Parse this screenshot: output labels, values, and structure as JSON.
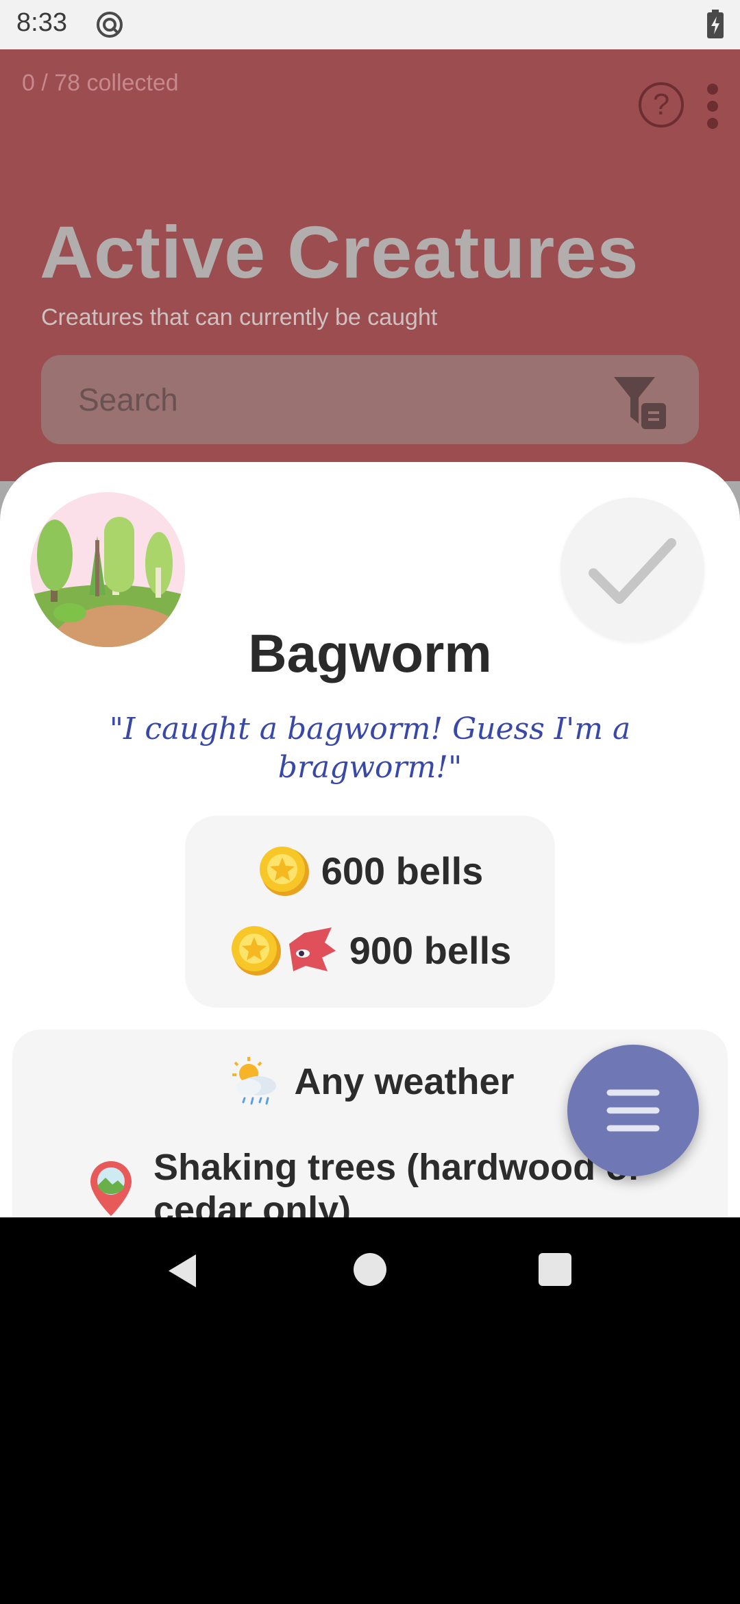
{
  "status_bar": {
    "time": "8:33"
  },
  "header": {
    "collected": "0 / 78 collected",
    "help_label": "?",
    "title": "Active Creatures",
    "subtitle": "Creatures that can currently be caught",
    "search": {
      "placeholder": "Search"
    }
  },
  "creature": {
    "name": "Bagworm",
    "quote": "\"I caught a bagworm! Guess I'm a bragworm!\"",
    "prices": [
      {
        "label": "600 bells",
        "icon": "bell-coin-icon"
      },
      {
        "label": "900 bells",
        "icon": "flick-coin-icon"
      }
    ],
    "weather": {
      "label": "Any weather",
      "icon": "weather-icon"
    },
    "location": {
      "label": "Shaking trees (hardwood or cedar only)",
      "icon": "location-pin-icon"
    }
  },
  "colors": {
    "header_bg": "#9b4d4f",
    "fab": "#6f78b4",
    "quote": "#3848a8"
  }
}
